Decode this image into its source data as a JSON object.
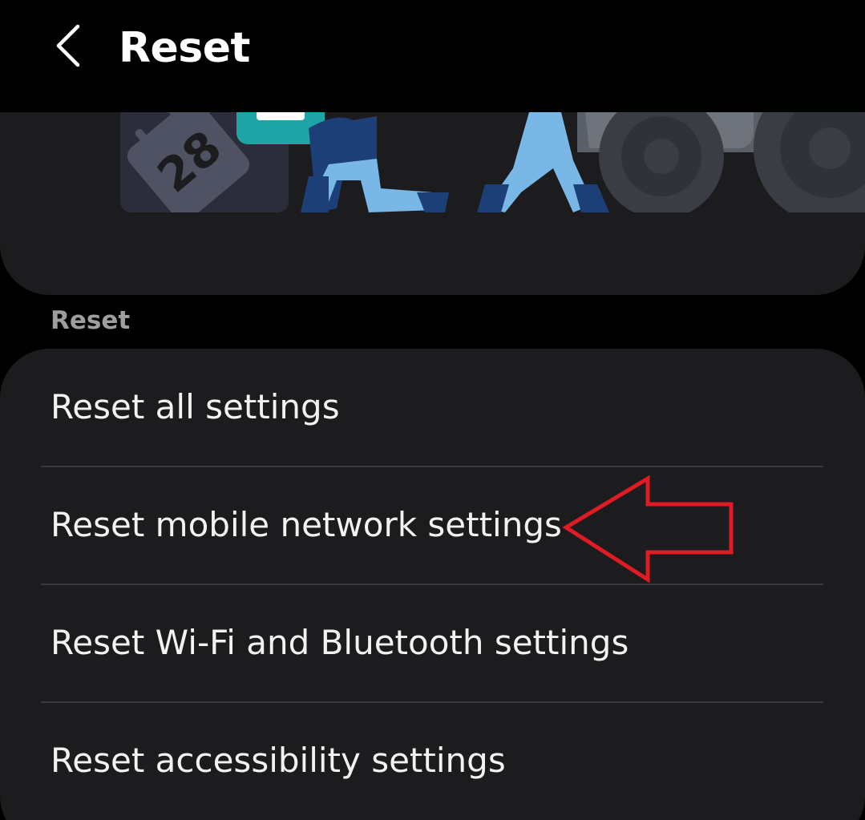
{
  "app_bar": {
    "title": "Reset",
    "back_icon": "chevron-left-icon"
  },
  "hero": {
    "calendar_number": "28"
  },
  "section": {
    "header": "Reset"
  },
  "reset_list": {
    "items": [
      {
        "label": "Reset all settings"
      },
      {
        "label": "Reset mobile network settings"
      },
      {
        "label": "Reset Wi-Fi and Bluetooth settings"
      },
      {
        "label": "Reset accessibility settings"
      }
    ]
  },
  "annotation": {
    "icon": "arrow-left-icon",
    "color": "#e01b24"
  },
  "colors": {
    "background": "#000000",
    "card": "#1c1c1e",
    "divider": "#3a3a3c",
    "section_header": "#9e9e9e"
  }
}
